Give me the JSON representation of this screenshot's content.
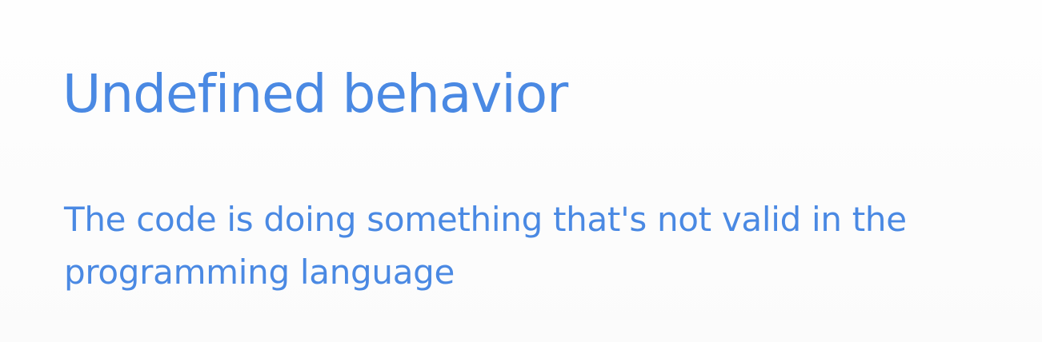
{
  "slide": {
    "title": "Undefined behavior",
    "body": "The code is doing something that's not valid in the programming language",
    "text_color": "#4a89e3",
    "background_color": "#fdfdfd"
  }
}
